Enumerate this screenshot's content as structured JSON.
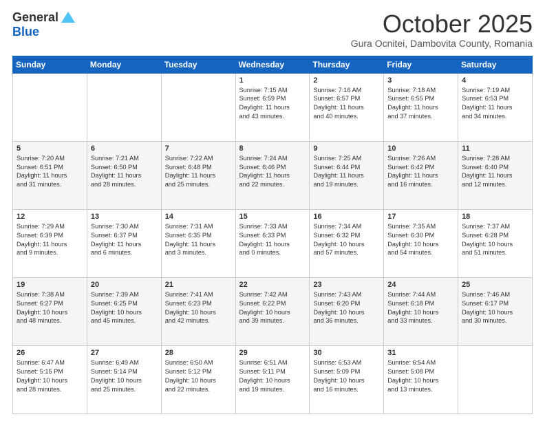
{
  "header": {
    "logo_general": "General",
    "logo_blue": "Blue",
    "month_title": "October 2025",
    "subtitle": "Gura Ocnitei, Dambovita County, Romania"
  },
  "weekdays": [
    "Sunday",
    "Monday",
    "Tuesday",
    "Wednesday",
    "Thursday",
    "Friday",
    "Saturday"
  ],
  "weeks": [
    [
      {
        "day": "",
        "text": ""
      },
      {
        "day": "",
        "text": ""
      },
      {
        "day": "",
        "text": ""
      },
      {
        "day": "1",
        "text": "Sunrise: 7:15 AM\nSunset: 6:59 PM\nDaylight: 11 hours\nand 43 minutes."
      },
      {
        "day": "2",
        "text": "Sunrise: 7:16 AM\nSunset: 6:57 PM\nDaylight: 11 hours\nand 40 minutes."
      },
      {
        "day": "3",
        "text": "Sunrise: 7:18 AM\nSunset: 6:55 PM\nDaylight: 11 hours\nand 37 minutes."
      },
      {
        "day": "4",
        "text": "Sunrise: 7:19 AM\nSunset: 6:53 PM\nDaylight: 11 hours\nand 34 minutes."
      }
    ],
    [
      {
        "day": "5",
        "text": "Sunrise: 7:20 AM\nSunset: 6:51 PM\nDaylight: 11 hours\nand 31 minutes."
      },
      {
        "day": "6",
        "text": "Sunrise: 7:21 AM\nSunset: 6:50 PM\nDaylight: 11 hours\nand 28 minutes."
      },
      {
        "day": "7",
        "text": "Sunrise: 7:22 AM\nSunset: 6:48 PM\nDaylight: 11 hours\nand 25 minutes."
      },
      {
        "day": "8",
        "text": "Sunrise: 7:24 AM\nSunset: 6:46 PM\nDaylight: 11 hours\nand 22 minutes."
      },
      {
        "day": "9",
        "text": "Sunrise: 7:25 AM\nSunset: 6:44 PM\nDaylight: 11 hours\nand 19 minutes."
      },
      {
        "day": "10",
        "text": "Sunrise: 7:26 AM\nSunset: 6:42 PM\nDaylight: 11 hours\nand 16 minutes."
      },
      {
        "day": "11",
        "text": "Sunrise: 7:28 AM\nSunset: 6:40 PM\nDaylight: 11 hours\nand 12 minutes."
      }
    ],
    [
      {
        "day": "12",
        "text": "Sunrise: 7:29 AM\nSunset: 6:39 PM\nDaylight: 11 hours\nand 9 minutes."
      },
      {
        "day": "13",
        "text": "Sunrise: 7:30 AM\nSunset: 6:37 PM\nDaylight: 11 hours\nand 6 minutes."
      },
      {
        "day": "14",
        "text": "Sunrise: 7:31 AM\nSunset: 6:35 PM\nDaylight: 11 hours\nand 3 minutes."
      },
      {
        "day": "15",
        "text": "Sunrise: 7:33 AM\nSunset: 6:33 PM\nDaylight: 11 hours\nand 0 minutes."
      },
      {
        "day": "16",
        "text": "Sunrise: 7:34 AM\nSunset: 6:32 PM\nDaylight: 10 hours\nand 57 minutes."
      },
      {
        "day": "17",
        "text": "Sunrise: 7:35 AM\nSunset: 6:30 PM\nDaylight: 10 hours\nand 54 minutes."
      },
      {
        "day": "18",
        "text": "Sunrise: 7:37 AM\nSunset: 6:28 PM\nDaylight: 10 hours\nand 51 minutes."
      }
    ],
    [
      {
        "day": "19",
        "text": "Sunrise: 7:38 AM\nSunset: 6:27 PM\nDaylight: 10 hours\nand 48 minutes."
      },
      {
        "day": "20",
        "text": "Sunrise: 7:39 AM\nSunset: 6:25 PM\nDaylight: 10 hours\nand 45 minutes."
      },
      {
        "day": "21",
        "text": "Sunrise: 7:41 AM\nSunset: 6:23 PM\nDaylight: 10 hours\nand 42 minutes."
      },
      {
        "day": "22",
        "text": "Sunrise: 7:42 AM\nSunset: 6:22 PM\nDaylight: 10 hours\nand 39 minutes."
      },
      {
        "day": "23",
        "text": "Sunrise: 7:43 AM\nSunset: 6:20 PM\nDaylight: 10 hours\nand 36 minutes."
      },
      {
        "day": "24",
        "text": "Sunrise: 7:44 AM\nSunset: 6:18 PM\nDaylight: 10 hours\nand 33 minutes."
      },
      {
        "day": "25",
        "text": "Sunrise: 7:46 AM\nSunset: 6:17 PM\nDaylight: 10 hours\nand 30 minutes."
      }
    ],
    [
      {
        "day": "26",
        "text": "Sunrise: 6:47 AM\nSunset: 5:15 PM\nDaylight: 10 hours\nand 28 minutes."
      },
      {
        "day": "27",
        "text": "Sunrise: 6:49 AM\nSunset: 5:14 PM\nDaylight: 10 hours\nand 25 minutes."
      },
      {
        "day": "28",
        "text": "Sunrise: 6:50 AM\nSunset: 5:12 PM\nDaylight: 10 hours\nand 22 minutes."
      },
      {
        "day": "29",
        "text": "Sunrise: 6:51 AM\nSunset: 5:11 PM\nDaylight: 10 hours\nand 19 minutes."
      },
      {
        "day": "30",
        "text": "Sunrise: 6:53 AM\nSunset: 5:09 PM\nDaylight: 10 hours\nand 16 minutes."
      },
      {
        "day": "31",
        "text": "Sunrise: 6:54 AM\nSunset: 5:08 PM\nDaylight: 10 hours\nand 13 minutes."
      },
      {
        "day": "",
        "text": ""
      }
    ]
  ]
}
